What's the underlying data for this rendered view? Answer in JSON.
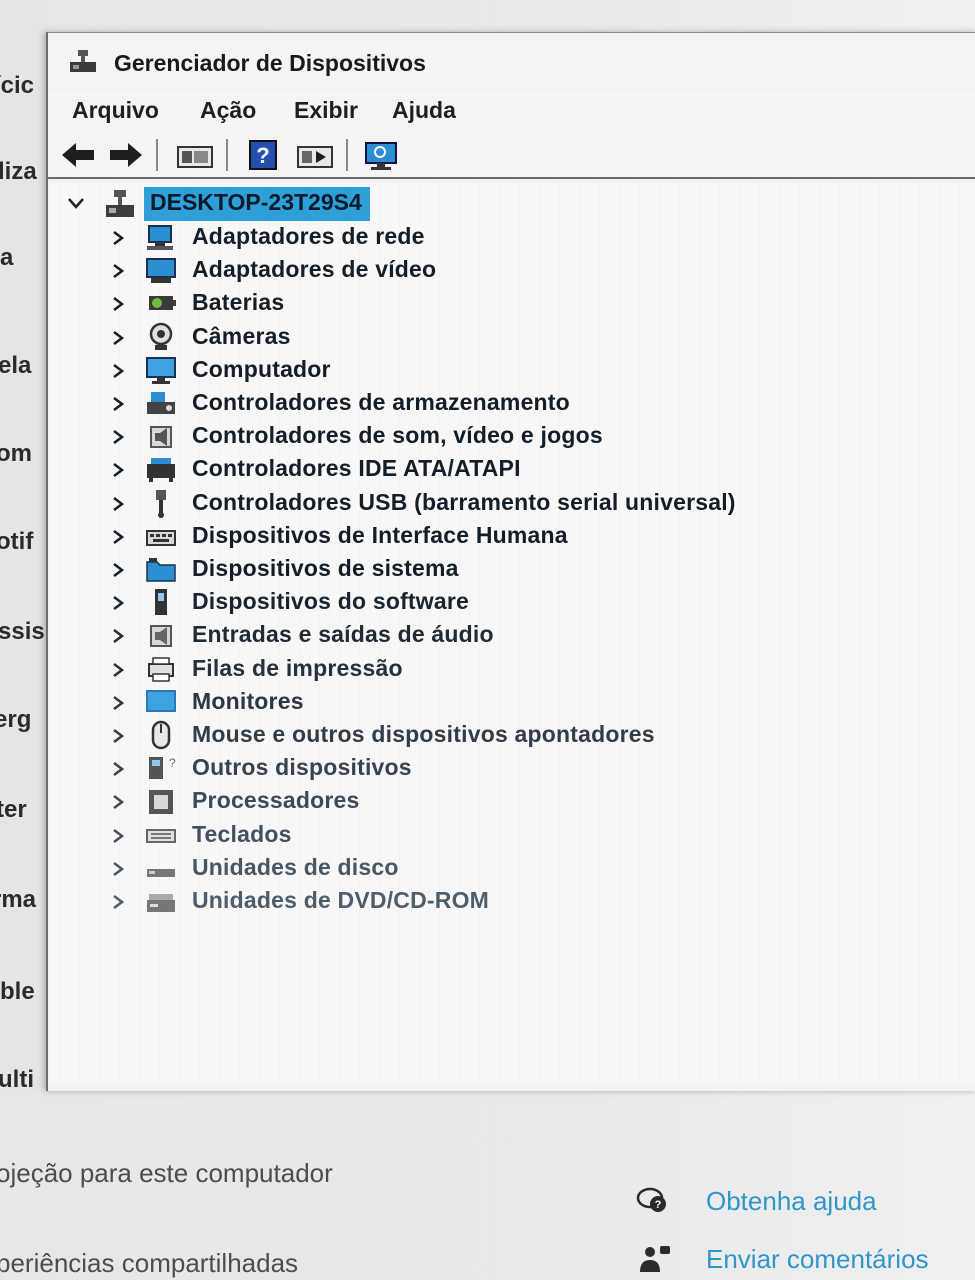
{
  "background_window": {
    "left_fragments": [
      "ícic",
      "liza",
      "a",
      "ela",
      "om",
      "otif",
      "ssis",
      "erg",
      "ter",
      "rma",
      "ble",
      "ulti"
    ],
    "bottom_texts": [
      "ojeção para este computador",
      "periências compartilhadas"
    ],
    "links": [
      {
        "label": "Obtenha ajuda",
        "icon": "help-chat-icon"
      },
      {
        "label": "Enviar comentários",
        "icon": "feedback-person-icon"
      }
    ],
    "link_color": "#2f96c9"
  },
  "device_manager": {
    "title": "Gerenciador de Dispositivos",
    "title_icon": "device-manager-icon",
    "menu": [
      "Arquivo",
      "Ação",
      "Exibir",
      "Ajuda"
    ],
    "toolbar": [
      "back-arrow-icon",
      "forward-arrow-icon",
      "properties-icon",
      "help-icon",
      "update-driver-icon",
      "scan-hardware-icon"
    ],
    "root": {
      "label": "DESKTOP-23T29S4",
      "icon": "computer-icon",
      "expanded": true,
      "selected": true
    },
    "categories": [
      {
        "label": "Adaptadores de rede",
        "icon": "network-adapter-icon"
      },
      {
        "label": "Adaptadores de vídeo",
        "icon": "display-adapter-icon"
      },
      {
        "label": "Baterias",
        "icon": "battery-icon"
      },
      {
        "label": "Câmeras",
        "icon": "camera-icon"
      },
      {
        "label": "Computador",
        "icon": "computer-monitor-icon"
      },
      {
        "label": "Controladores de armazenamento",
        "icon": "storage-controller-icon"
      },
      {
        "label": "Controladores de som, vídeo e jogos",
        "icon": "speaker-icon"
      },
      {
        "label": "Controladores IDE ATA/ATAPI",
        "icon": "ide-controller-icon"
      },
      {
        "label": "Controladores USB (barramento serial universal)",
        "icon": "usb-icon"
      },
      {
        "label": "Dispositivos de Interface Humana",
        "icon": "hid-icon"
      },
      {
        "label": "Dispositivos de sistema",
        "icon": "system-folder-icon"
      },
      {
        "label": "Dispositivos do software",
        "icon": "software-device-icon"
      },
      {
        "label": "Entradas e saídas de áudio",
        "icon": "audio-io-icon"
      },
      {
        "label": "Filas de impressão",
        "icon": "printer-icon"
      },
      {
        "label": "Monitores",
        "icon": "monitor-icon"
      },
      {
        "label": "Mouse e outros dispositivos apontadores",
        "icon": "mouse-icon"
      },
      {
        "label": "Outros dispositivos",
        "icon": "unknown-device-icon"
      },
      {
        "label": "Processadores",
        "icon": "processor-icon"
      },
      {
        "label": "Teclados",
        "icon": "keyboard-icon"
      },
      {
        "label": "Unidades de disco",
        "icon": "disk-drive-icon"
      },
      {
        "label": "Unidades de DVD/CD-ROM",
        "icon": "dvd-drive-icon"
      }
    ],
    "colors": {
      "selection": "#2f9fd8",
      "accent_icon": "#2a8ed0"
    }
  }
}
